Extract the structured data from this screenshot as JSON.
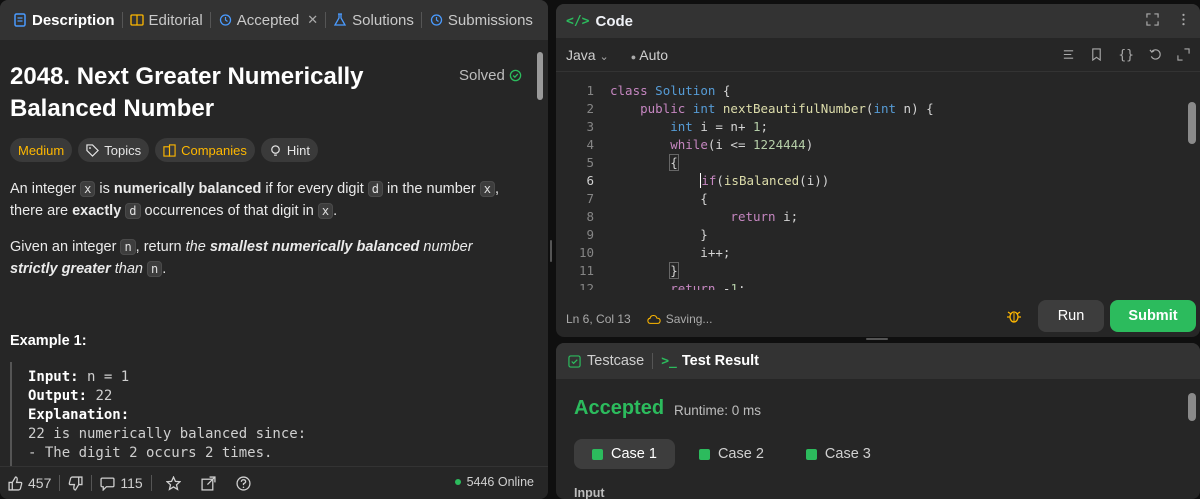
{
  "left": {
    "tabs": [
      {
        "label": "Description",
        "icon": "description-icon"
      },
      {
        "label": "Editorial",
        "icon": "book-icon"
      },
      {
        "label": "Accepted",
        "icon": "history-icon"
      },
      {
        "label": "Solutions",
        "icon": "flask-icon"
      },
      {
        "label": "Submissions",
        "icon": "history-icon"
      }
    ],
    "close_glyph": "✕",
    "title": "2048. Next Greater Numerically Balanced Number",
    "solved": "Solved",
    "tags": [
      "Medium",
      "Topics",
      "Companies",
      "Hint"
    ],
    "p1": {
      "a": "An integer ",
      "x1": "x",
      "b": " is ",
      "bold1": "numerically balanced",
      "c": " if for every digit ",
      "d1": "d",
      "e": " in the number ",
      "x2": "x",
      "f": ", there are ",
      "bold2": "exactly",
      "g": " ",
      "d2": "d",
      "h": " occurrences of that digit in ",
      "x3": "x",
      "i": "."
    },
    "p2": {
      "a": "Given an integer ",
      "n1": "n",
      "b": ", return ",
      "it1": "the ",
      "bi1": "smallest numerically balanced",
      "c": " number ",
      "bi2": "strictly greater",
      "it2": " than ",
      "n2": "n",
      "d": "."
    },
    "example_title": "Example 1:",
    "example": {
      "input_label": "Input:",
      "input_value": " n = 1",
      "output_label": "Output:",
      "output_value": " 22",
      "explanation_label": "Explanation:",
      "line1": "22 is numerically balanced since:",
      "line2": "- The digit 2 occurs 2 times."
    },
    "footer": {
      "likes": "457",
      "comments": "115",
      "online": "5446 Online"
    }
  },
  "code": {
    "title": "Code",
    "language": "Java",
    "mode": "Auto",
    "lines": [
      "1",
      "2",
      "3",
      "4",
      "5",
      "6",
      "7",
      "8",
      "9",
      "10",
      "11",
      "12"
    ],
    "cursor": "Ln 6, Col 13",
    "saving": "Saving...",
    "run": "Run",
    "submit": "Submit"
  },
  "result": {
    "tab_testcase": "Testcase",
    "tab_result": "Test Result",
    "status": "Accepted",
    "runtime": "Runtime: 0 ms",
    "cases": [
      "Case 1",
      "Case 2",
      "Case 3"
    ],
    "input_label": "Input"
  },
  "colors": {
    "accent": "#2cbb5d",
    "medium": "#ffb800"
  }
}
